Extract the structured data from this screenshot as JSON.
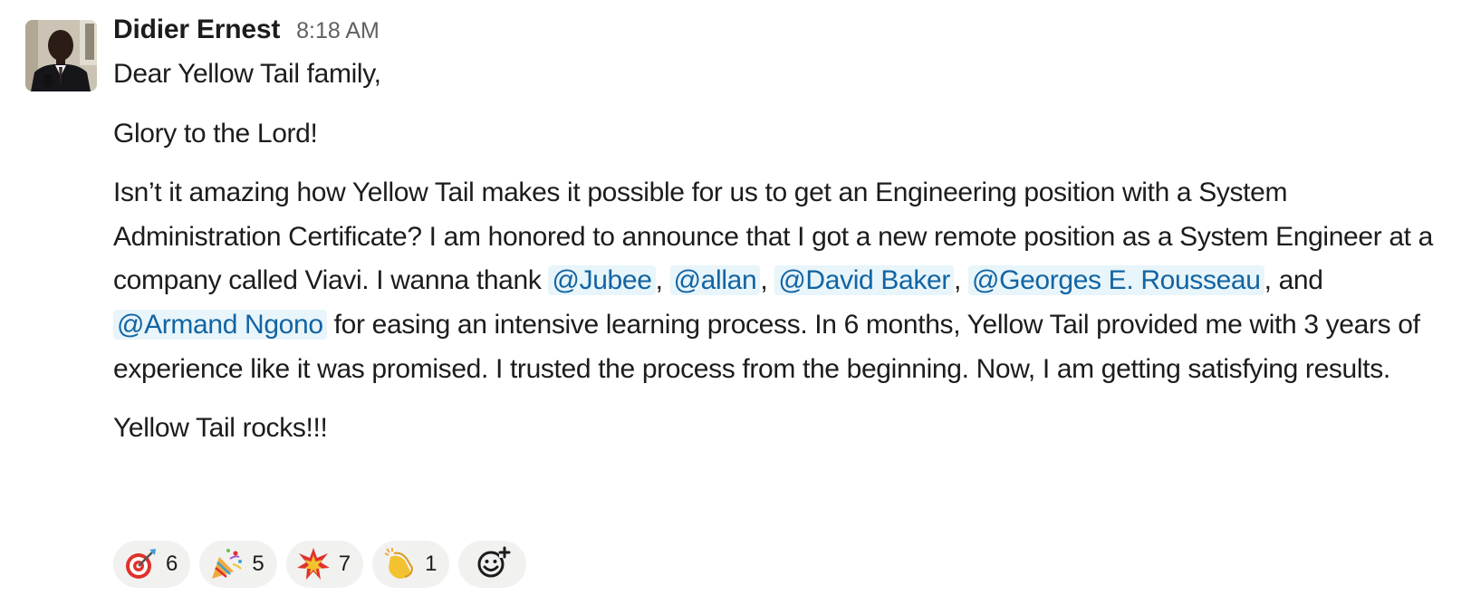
{
  "message": {
    "sender": "Didier Ernest",
    "timestamp": "8:18 AM",
    "greeting": "Dear Yellow Tail family,",
    "line2": "Glory to the Lord!",
    "para": {
      "t1": "Isn’t it amazing how Yellow Tail makes it possible for us to get an Engineering position with a System Administration Certificate? I am honored to announce that I got a new remote position as a System Engineer at a company called Viavi. I wanna thank ",
      "comma": ",",
      "and": ", and ",
      "t2": " for easing an intensive learning process. In 6 months, Yellow Tail provided me with 3 years of experience like it was promised. I trusted the process from the beginning. Now, I am getting satisfying results."
    },
    "mentions": [
      "@Jubee",
      "@allan",
      "@David Baker",
      "@Georges E. Rousseau",
      "@Armand Ngono"
    ],
    "closing": "Yellow Tail rocks!!!"
  },
  "reactions": [
    {
      "emoji": "dart-icon",
      "count": "6"
    },
    {
      "emoji": "party-popper-icon",
      "count": "5"
    },
    {
      "emoji": "collision-icon",
      "count": "7"
    },
    {
      "emoji": "clapping-hands-icon",
      "count": "1"
    }
  ],
  "colors": {
    "mention_bg": "#e8f5fa",
    "mention_text": "#1264a3",
    "reaction_bg": "#f1f1f0",
    "timestamp": "#616061"
  }
}
